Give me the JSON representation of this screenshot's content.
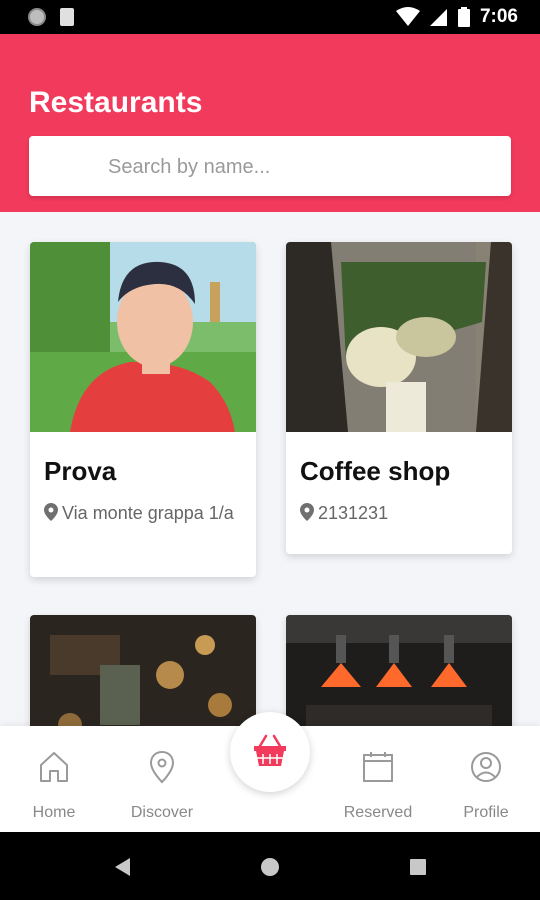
{
  "status_bar": {
    "time": "7:06"
  },
  "header": {
    "title": "Restaurants"
  },
  "search": {
    "placeholder": "Search by name..."
  },
  "restaurants": [
    {
      "name": "Prova",
      "address": "Via monte grappa 1/a"
    },
    {
      "name": "Coffee shop",
      "address": "2131231"
    },
    {
      "name": "",
      "address": ""
    },
    {
      "name": "",
      "address": ""
    }
  ],
  "bottom_nav": {
    "items": [
      {
        "label": "Home",
        "icon": "home-icon"
      },
      {
        "label": "Discover",
        "icon": "location-pin-icon"
      },
      {
        "label": "",
        "icon": "basket-icon"
      },
      {
        "label": "Reserved",
        "icon": "calendar-icon"
      },
      {
        "label": "Profile",
        "icon": "profile-icon"
      }
    ]
  },
  "colors": {
    "accent": "#f23a5c",
    "background": "#f3f5f9",
    "nav_label": "#888888"
  }
}
